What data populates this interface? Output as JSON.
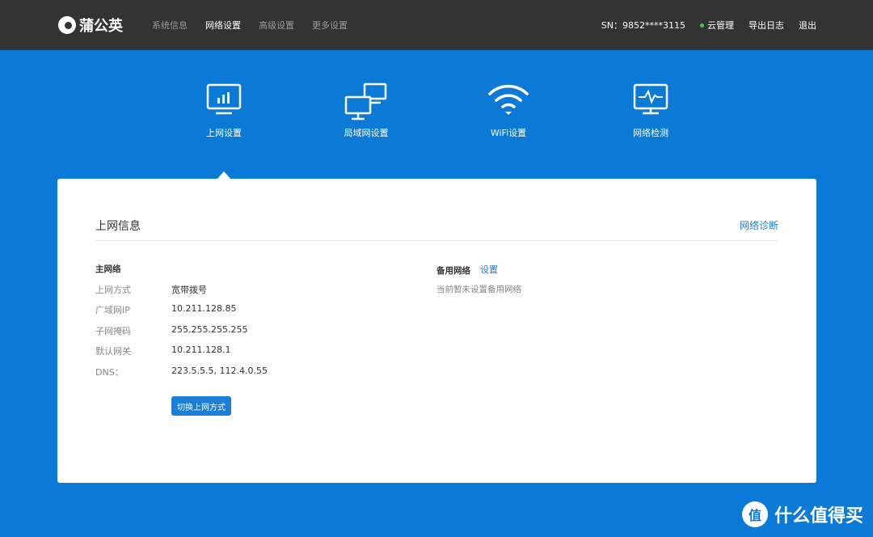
{
  "brand": {
    "name": "蒲公英"
  },
  "nav": {
    "items": [
      {
        "label": "系统信息",
        "active": false
      },
      {
        "label": "网络设置",
        "active": true
      },
      {
        "label": "高级设置",
        "active": false
      },
      {
        "label": "更多设置",
        "active": false
      }
    ]
  },
  "header_right": {
    "sn": "SN：9852****3115",
    "cloud": "云管理",
    "export_log": "导出日志",
    "logout": "退出"
  },
  "tabs": [
    {
      "label": "上网设置",
      "icon": "monitor-chart-icon",
      "active": true
    },
    {
      "label": "局域网设置",
      "icon": "lan-computers-icon",
      "active": false
    },
    {
      "label": "WiFi设置",
      "icon": "wifi-icon",
      "active": false
    },
    {
      "label": "网络检测",
      "icon": "network-check-icon",
      "active": false
    }
  ],
  "card": {
    "title": "上网信息",
    "diagnose_link": "网络诊断",
    "primary": {
      "section_title": "主网络",
      "rows": [
        {
          "label": "上网方式",
          "value": "宽带拨号"
        },
        {
          "label": "广域网IP",
          "value": "10.211.128.85"
        },
        {
          "label": "子网掩码",
          "value": "255.255.255.255"
        },
        {
          "label": "默认网关",
          "value": "10.211.128.1"
        },
        {
          "label": "DNS：",
          "value": "223.5.5.5, 112.4.0.55"
        }
      ],
      "switch_button": "切换上网方式"
    },
    "backup": {
      "section_title": "备用网络",
      "set_link": "设置",
      "note": "当前暂未设置备用网络"
    }
  },
  "watermark": {
    "badge": "值",
    "text": "什么值得买"
  },
  "colors": {
    "topbar": "#333333",
    "background": "#0a7ad6",
    "accent": "#1a7fd6",
    "status_green": "#3ecf3e"
  }
}
